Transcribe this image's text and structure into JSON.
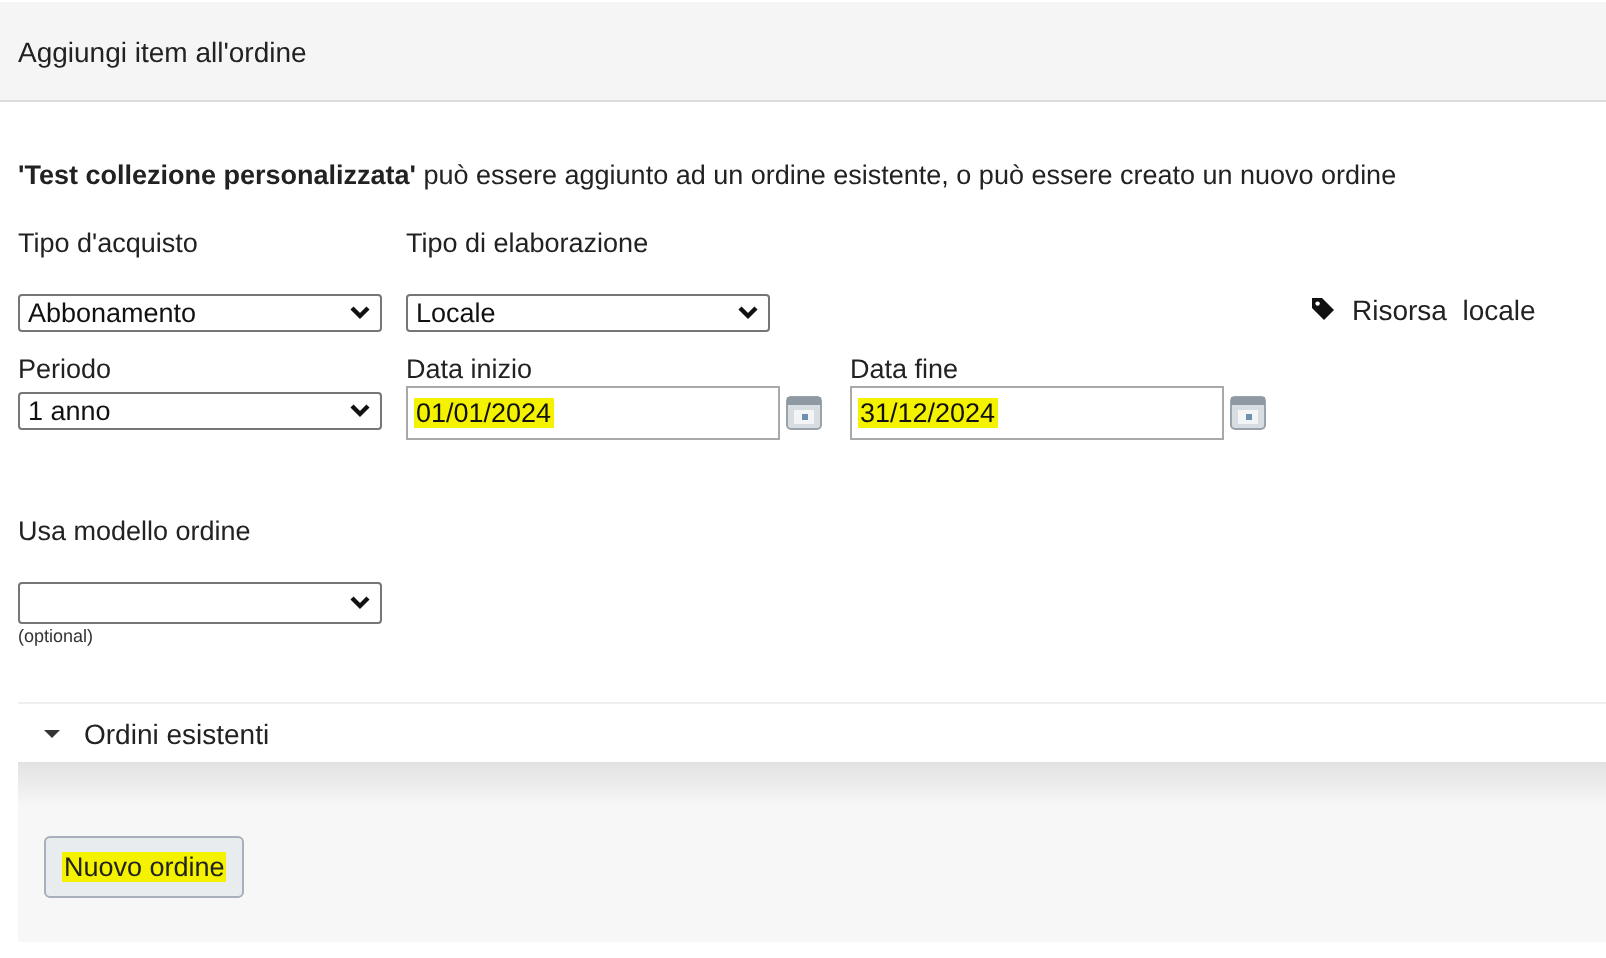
{
  "page_title": "Aggiungi item all'ordine",
  "intro": "**'Test collezione personalizzata'** può essere aggiunto ad un ordine esistente, o può essere creato un nuovo ordine",
  "row_1": [
    {
      "label": "Tipo d'acquisto",
      "kind": "select",
      "value": "Abbonamento"
    },
    {
      "label": "Tipo di elaborazione",
      "kind": "select",
      "value": "Locale"
    }
  ],
  "resource_tag": "Risorsa  locale",
  "row_2": [
    {
      "label": "Periodo",
      "kind": "select",
      "value": "1 anno"
    },
    {
      "label": "Data inizio",
      "kind": "date",
      "value": "01/01/2024",
      "highlighted": true
    },
    {
      "label": "Data fine",
      "kind": "date",
      "value": "31/12/2024",
      "highlighted": true
    }
  ],
  "template": {
    "label": "Usa modello ordine",
    "hint": "(optional)"
  },
  "section": {
    "title": "Ordini esistenti",
    "expanded": true
  },
  "button": {
    "label": "Nuovo ordine",
    "highlighted": true
  }
}
